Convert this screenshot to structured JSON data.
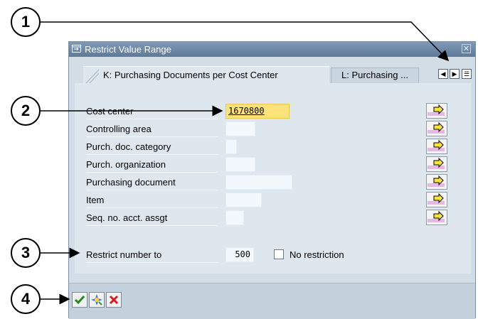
{
  "window": {
    "title": "Restrict Value Range",
    "close_icon": "close-icon"
  },
  "tabs": [
    {
      "label": "K: Purchasing Documents per Cost Center",
      "active": true
    },
    {
      "label": "L: Purchasing ...",
      "active": false
    }
  ],
  "tab_nav": {
    "icons": [
      "tab-prev-icon",
      "tab-next-icon",
      "tab-list-icon"
    ]
  },
  "fields": [
    {
      "label": "Cost center",
      "value": "1670800"
    },
    {
      "label": "Controlling area",
      "value": ""
    },
    {
      "label": "Purch. doc. category",
      "value": ""
    },
    {
      "label": "Purch. organization",
      "value": ""
    },
    {
      "label": "Purchasing document",
      "value": ""
    },
    {
      "label": "Item",
      "value": ""
    },
    {
      "label": "Seq. no. acct. assgt",
      "value": ""
    }
  ],
  "restrict": {
    "label": "Restrict number to",
    "value": "500",
    "no_restriction_label": "No restriction",
    "no_restriction_checked": false
  },
  "footer": {
    "buttons": [
      "continue-checkmark-icon",
      "search-execute-icon",
      "cancel-x-icon"
    ]
  },
  "callouts": [
    "1",
    "2",
    "3",
    "4"
  ],
  "colors": {
    "titlebar": "#6f8aa8",
    "highlight_field": "#ffe37a",
    "dialog_bg": "#d2dde6"
  }
}
